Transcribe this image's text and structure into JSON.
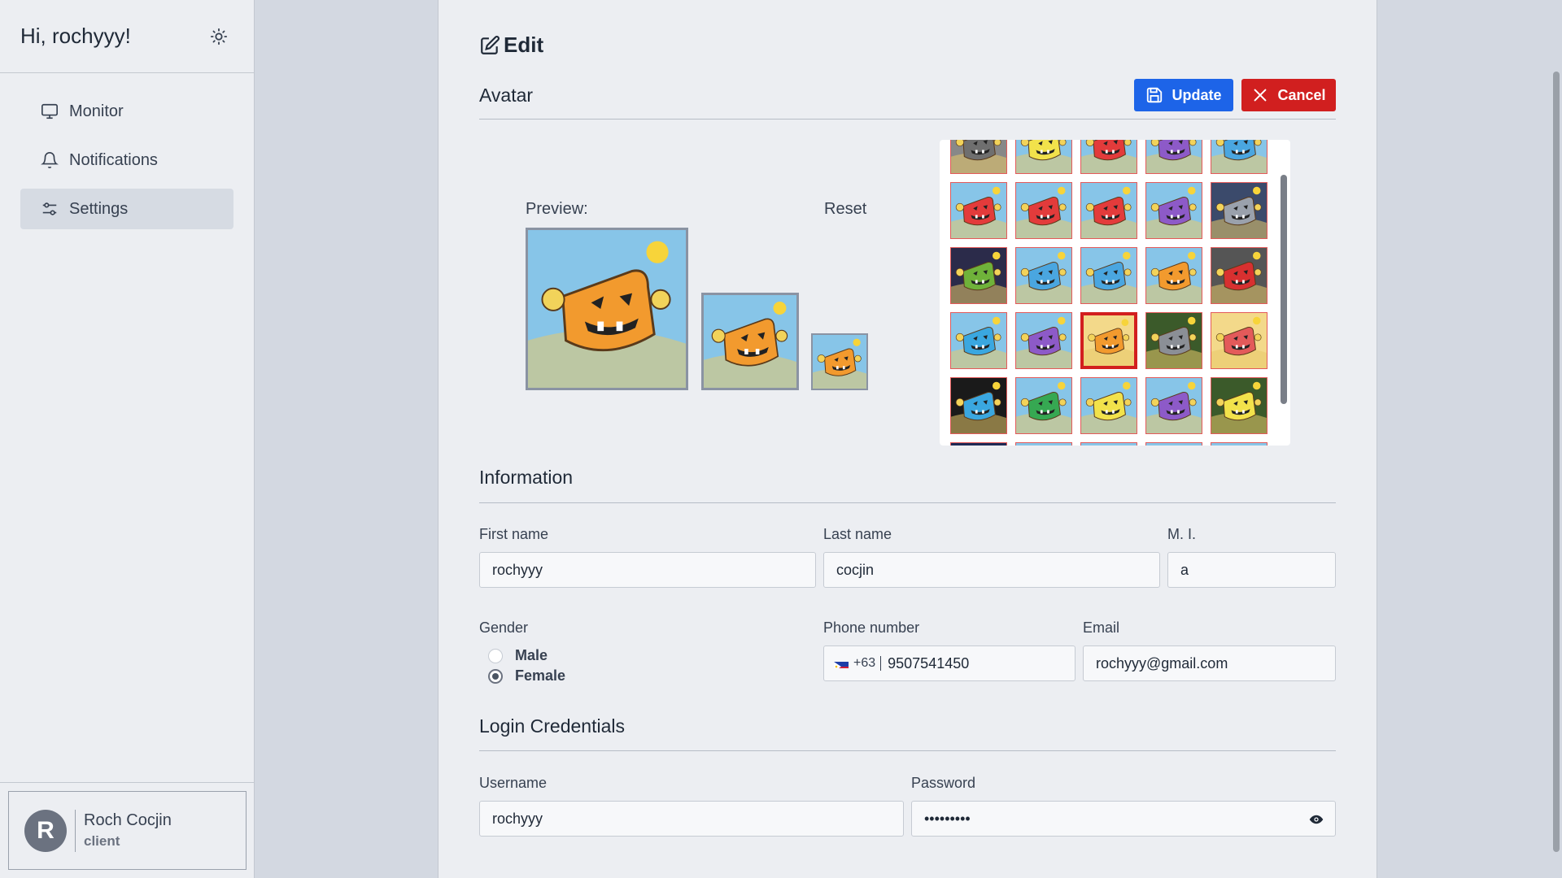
{
  "sidebar": {
    "greeting": "Hi, rochyyy!",
    "theme_icon": "sun-icon",
    "items": [
      {
        "label": "Monitor",
        "icon": "monitor-icon",
        "active": false
      },
      {
        "label": "Notifications",
        "icon": "bell-icon",
        "active": false
      },
      {
        "label": "Settings",
        "icon": "sliders-icon",
        "active": true
      }
    ],
    "user": {
      "initial": "R",
      "name": "Roch Cocjin",
      "role": "client"
    }
  },
  "edit": {
    "title": "Edit",
    "avatar_section": "Avatar",
    "update_label": "Update",
    "cancel_label": "Cancel",
    "preview_label": "Preview:",
    "reset_label": "Reset",
    "avatar_grid": {
      "rows": [
        [
          "#6f6f6f",
          "#f2e24b",
          "#e33b3b",
          "#8d5ac8",
          "#4aa6e0"
        ],
        [
          "#e33b3b",
          "#e33b3b",
          "#e33b3b",
          "#8d5ac8",
          "#9aa1ac"
        ],
        [
          "#6fb23a",
          "#4aa6e0",
          "#4aa6e0",
          "#f29a2e",
          "#d83030"
        ],
        [
          "#3aa7e0",
          "#8d5ac8",
          "#f29a2e",
          "#8b8f96",
          "#e35a5a"
        ],
        [
          "#3aa7e0",
          "#36a852",
          "#f2e24b",
          "#8d5ac8",
          "#f2e24b"
        ],
        [
          "#2f3e7a",
          "#9aa1ac",
          "#4aa6e0",
          "#4aa6e0",
          "#36a852"
        ]
      ],
      "bg_colors": [
        [
          "#888888",
          "#87c5e8",
          "#87c5e8",
          "#87c5e8",
          "#87c5e8"
        ],
        [
          "#87c5e8",
          "#87c5e8",
          "#87c5e8",
          "#87c5e8",
          "#3b4a6b"
        ],
        [
          "#2b2b4a",
          "#87c5e8",
          "#87c5e8",
          "#87c5e8",
          "#555555"
        ],
        [
          "#87c5e8",
          "#87c5e8",
          "#f3d98a",
          "#3b5a2a",
          "#f3d98a"
        ],
        [
          "#1a1a1a",
          "#87c5e8",
          "#87c5e8",
          "#87c5e8",
          "#3b5a2a"
        ],
        [
          "#1e2a55",
          "#87c5e8",
          "#87c5e8",
          "#87c5e8",
          "#87c5e8"
        ]
      ],
      "selected": [
        3,
        2
      ]
    },
    "info_section": "Information",
    "first_name": {
      "label": "First name",
      "value": "rochyyy"
    },
    "last_name": {
      "label": "Last name",
      "value": "cocjin"
    },
    "mi": {
      "label": "M. I.",
      "value": "a"
    },
    "gender": {
      "label": "Gender",
      "options": [
        "Male",
        "Female"
      ],
      "selected": "Female"
    },
    "phone": {
      "label": "Phone number",
      "dial_code": "+63",
      "value": "9507541450"
    },
    "email": {
      "label": "Email",
      "value": "rochyyy@gmail.com"
    },
    "login_section": "Login Credentials",
    "username": {
      "label": "Username",
      "value": "rochyyy"
    },
    "password": {
      "label": "Password",
      "value": "•••••••••"
    }
  },
  "colors": {
    "update": "#1d64e8",
    "cancel": "#d11f1f",
    "avatar_main": "#f29a2e"
  }
}
